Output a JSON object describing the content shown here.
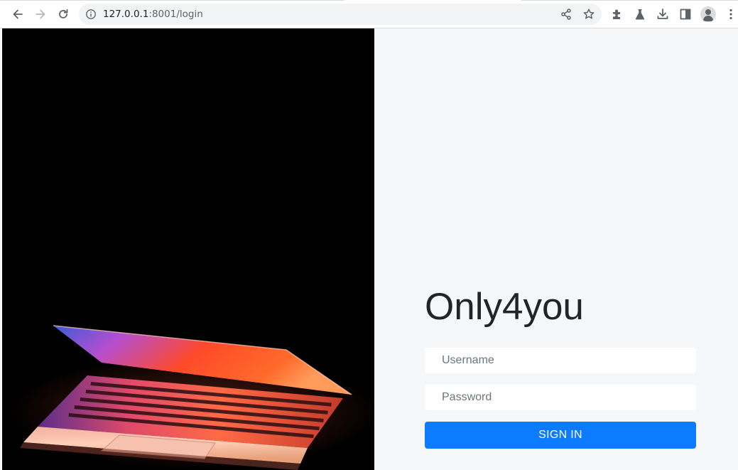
{
  "browser": {
    "url_host": "127.0.0.1",
    "url_rest": ":8001/login"
  },
  "page": {
    "brand_title": "Only4you",
    "login_form": {
      "username_placeholder": "Username",
      "password_placeholder": "Password",
      "submit_label": "SIGN IN"
    }
  },
  "colors": {
    "page_background": "#f6f7f9",
    "hero_background": "#000000",
    "button_primary": "#0d7bff",
    "button_text": "#ffffff",
    "title_text": "#212529"
  }
}
